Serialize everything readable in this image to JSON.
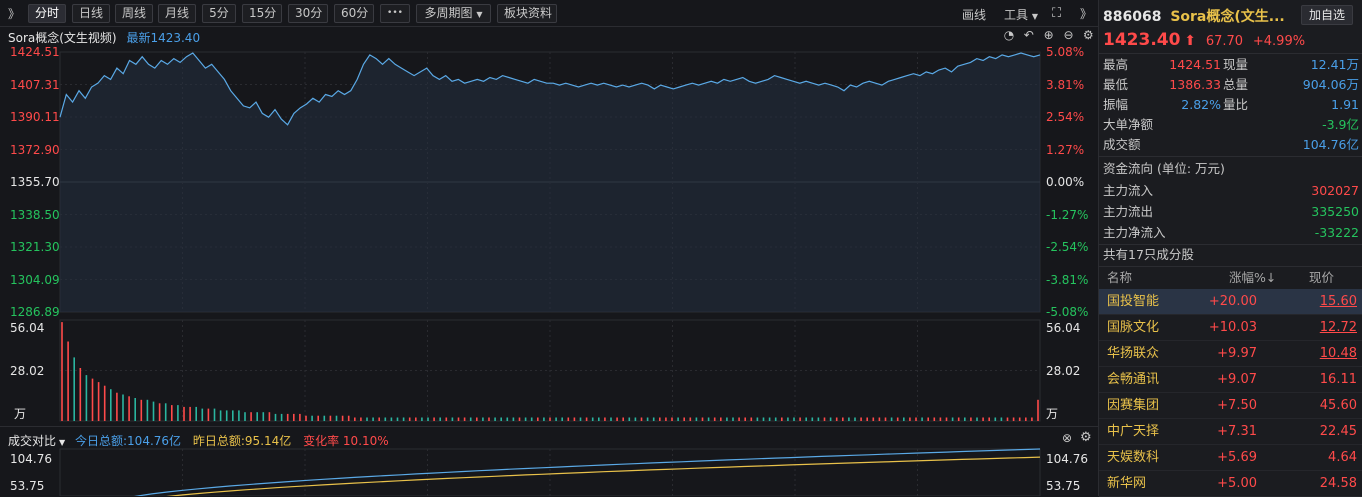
{
  "toolbar": {
    "collapse_left": "》",
    "tabs": [
      "分时",
      "日线",
      "周线",
      "月线",
      "5分",
      "15分",
      "30分",
      "60分"
    ],
    "more": "•••",
    "multi_period": "多周期图",
    "block_info": "板块资料",
    "draw_line": "画线",
    "tools": "工具",
    "collapse_right": "》"
  },
  "chart_header": {
    "name": "Sora概念(文生视频)",
    "latest_label": "最新1423.40"
  },
  "price_axis": {
    "left": [
      "1424.51",
      "1407.31",
      "1390.11",
      "1372.90",
      "1355.70",
      "1338.50",
      "1321.30",
      "1304.09",
      "1286.89"
    ],
    "right": [
      "5.08%",
      "3.81%",
      "2.54%",
      "1.27%",
      "0.00%",
      "-1.27%",
      "-2.54%",
      "-3.81%",
      "-5.08%"
    ]
  },
  "volume_axis": {
    "left": [
      "56.04",
      "28.02",
      "万"
    ],
    "right": [
      "56.04",
      "28.02",
      "万"
    ]
  },
  "compare": {
    "label": "成交对比",
    "today": "今日总额:104.76亿",
    "yesterday": "昨日总额:95.14亿",
    "change": "变化率 10.10%",
    "axis_left": [
      "104.76",
      "53.75"
    ],
    "axis_right": [
      "104.76",
      "53.75"
    ]
  },
  "colors": {
    "up": "#ff4a4a",
    "down": "#25c45e",
    "price_line": "#5aa9e6",
    "today_line": "#5aa9e6",
    "yesterday_line": "#e8c14a"
  },
  "quote": {
    "code": "886068",
    "name": "Sora概念(文生...",
    "add_btn": "加自选",
    "price": "1423.40",
    "change": "67.70",
    "pct": "+4.99%",
    "rows": [
      {
        "l1": "最高",
        "v1": "1424.51",
        "l2": "现量",
        "v2": "12.41万"
      },
      {
        "l1": "最低",
        "v1": "1386.33",
        "l2": "总量",
        "v2": "904.06万"
      },
      {
        "l1": "振幅",
        "v1": "2.82%",
        "l2": "量比",
        "v2": "1.91"
      }
    ],
    "big_net_label": "大单净额",
    "big_net": "-3.9亿",
    "turnover_label": "成交额",
    "turnover": "104.76亿"
  },
  "fund_flow": {
    "title": "资金流向 (单位: 万元)",
    "rows": [
      {
        "label": "主力流入",
        "value": "302027"
      },
      {
        "label": "主力流出",
        "value": "335250"
      },
      {
        "label": "主力净流入",
        "value": "-33222"
      }
    ]
  },
  "constituents": {
    "title": "共有17只成分股",
    "headers": [
      "名称",
      "涨幅%↓",
      "现价"
    ],
    "rows": [
      {
        "name": "国投智能",
        "pct": "+20.00",
        "price": "15.60"
      },
      {
        "name": "国脉文化",
        "pct": "+10.03",
        "price": "12.72"
      },
      {
        "name": "华扬联众",
        "pct": "+9.97",
        "price": "10.48"
      },
      {
        "name": "会畅通讯",
        "pct": "+9.07",
        "price": "16.11"
      },
      {
        "name": "因赛集团",
        "pct": "+7.50",
        "price": "45.60"
      },
      {
        "name": "中广天择",
        "pct": "+7.31",
        "price": "22.45"
      },
      {
        "name": "天娱数科",
        "pct": "+5.69",
        "price": "4.64"
      },
      {
        "name": "新华网",
        "pct": "+5.00",
        "price": "24.58"
      }
    ]
  },
  "chart_data": {
    "type": "line",
    "title": "Sora概念(文生视频)",
    "prev_close": 1355.7,
    "ylim": [
      1286.89,
      1424.51
    ],
    "price": [
      1390,
      1402,
      1398,
      1404,
      1400,
      1406,
      1408,
      1412,
      1410,
      1416,
      1413,
      1420,
      1418,
      1422,
      1418,
      1416,
      1420,
      1418,
      1421,
      1419,
      1422,
      1424,
      1420,
      1416,
      1418,
      1414,
      1410,
      1404,
      1400,
      1396,
      1395,
      1398,
      1392,
      1390,
      1394,
      1389,
      1386,
      1392,
      1395,
      1397,
      1400,
      1398,
      1402,
      1401,
      1404,
      1402,
      1404,
      1410,
      1418,
      1423,
      1421,
      1418,
      1421,
      1418,
      1416,
      1414,
      1412,
      1414,
      1416,
      1412,
      1410,
      1412,
      1409,
      1410,
      1408,
      1409,
      1410,
      1409,
      1411,
      1410,
      1412,
      1411,
      1410,
      1409,
      1408,
      1410,
      1409,
      1408,
      1408,
      1407,
      1408,
      1407,
      1406,
      1407,
      1408,
      1407,
      1408,
      1407,
      1406,
      1407,
      1406,
      1407,
      1408,
      1407,
      1405,
      1407,
      1406,
      1405,
      1406,
      1407,
      1408,
      1407,
      1408,
      1409,
      1408,
      1410,
      1409,
      1410,
      1411,
      1409,
      1408,
      1409,
      1410,
      1412,
      1411,
      1410,
      1409,
      1408,
      1409,
      1408,
      1407,
      1408,
      1407,
      1406,
      1404,
      1407,
      1406,
      1408,
      1409,
      1408,
      1407,
      1409,
      1410,
      1411,
      1412,
      1413,
      1412,
      1414,
      1413,
      1415,
      1416,
      1414,
      1417,
      1418,
      1419,
      1421,
      1420,
      1422,
      1421,
      1423,
      1422,
      1423,
      1424,
      1423,
      1422,
      1423
    ],
    "volume": [
      56,
      45,
      36,
      30,
      26,
      24,
      22,
      20,
      18,
      16,
      15,
      14,
      13,
      12,
      12,
      11,
      10,
      10,
      9,
      9,
      8,
      8,
      8,
      7,
      7,
      7,
      6,
      6,
      6,
      6,
      5,
      5,
      5,
      5,
      5,
      4,
      4,
      4,
      4,
      4,
      3,
      3,
      3,
      3,
      3,
      3,
      3,
      3,
      2,
      2,
      2,
      2,
      2,
      2,
      2,
      2,
      2,
      2,
      2,
      2,
      2,
      2,
      2,
      2,
      2,
      2,
      2,
      2,
      2,
      2,
      2,
      2,
      2,
      2,
      2,
      2,
      2,
      2,
      2,
      2,
      2,
      2,
      2,
      2,
      2,
      2,
      2,
      2,
      2,
      2,
      2,
      2,
      2,
      2,
      2,
      2,
      2,
      2,
      2,
      2,
      2,
      2,
      2,
      2,
      2,
      2,
      2,
      2,
      2,
      2,
      2,
      2,
      2,
      2,
      2,
      2,
      2,
      2,
      2,
      2,
      2,
      2,
      2,
      2,
      2,
      2,
      2,
      2,
      2,
      2,
      2,
      2,
      2,
      2,
      2,
      2,
      2,
      2,
      2,
      2,
      2,
      2,
      2,
      2,
      2,
      2,
      2,
      2,
      2,
      2,
      2,
      2,
      2,
      2,
      2,
      2,
      2,
      2,
      2,
      2,
      12
    ],
    "volume_max": 56.04,
    "turnover_today": 104.76,
    "turnover_yesterday": 95.14
  }
}
